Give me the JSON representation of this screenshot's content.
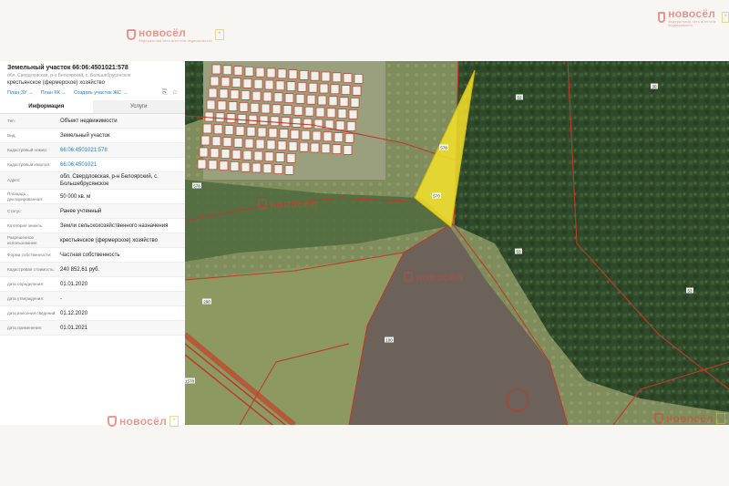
{
  "watermark": {
    "brand": "новосёл",
    "tagline": "Федеральная сеть агентств недвижимости"
  },
  "card": {
    "title": "Земельный участок 66:06:4501021:578",
    "address": "обл. Свердловская, р-н Белоярский, с. Большебрусянское",
    "use": "крестьянское (фермерское) хозяйство",
    "links": [
      "План ЗУ →",
      "План КК →",
      "Создать участок ЖС →"
    ],
    "tabs": [
      "Информация",
      "Услуги"
    ],
    "rows": [
      {
        "k": "Тип:",
        "v": "Объект недвижимости"
      },
      {
        "k": "Вид:",
        "v": "Земельный участок"
      },
      {
        "k": "Кадастровый номер:",
        "v": "66:06:4501021:578"
      },
      {
        "k": "Кадастровый квартал:",
        "v": "66:06:4501021"
      },
      {
        "k": "Адрес:",
        "v": "обл. Свердловская, р-н Белоярский, с. Большебрусянское"
      },
      {
        "k": "Площадь декларированная:",
        "v": "50 000 кв. м"
      },
      {
        "k": "Статус:",
        "v": "Ранее учтенный"
      },
      {
        "k": "Категория земель:",
        "v": "Земли сельскохозяйственного назначения"
      },
      {
        "k": "Разрешенное использование:",
        "v": "крестьянское (фермерское) хозяйство"
      },
      {
        "k": "Форма собственности:",
        "v": "Частная собственность"
      },
      {
        "k": "Кадастровая стоимость:",
        "v": "240 852,61 руб."
      },
      {
        "k": "дата определения:",
        "v": "01.01.2020"
      },
      {
        "k": "дата утверждения:",
        "v": "-"
      },
      {
        "k": "дата внесения сведений:",
        "v": "01.12.2020"
      },
      {
        "k": "дата применения:",
        "v": "01.01.2021"
      }
    ]
  },
  "map": {
    "parcel_labels": [
      "578",
      "570",
      "52",
      "30",
      "63",
      "53",
      "290",
      "100",
      "578",
      "1578"
    ],
    "colors": {
      "forest": "#2f4a2a",
      "field": "#7d8a5c",
      "plowed": "#6a6058",
      "selected": "#f4e22a",
      "boundary": "#c0392b"
    }
  }
}
